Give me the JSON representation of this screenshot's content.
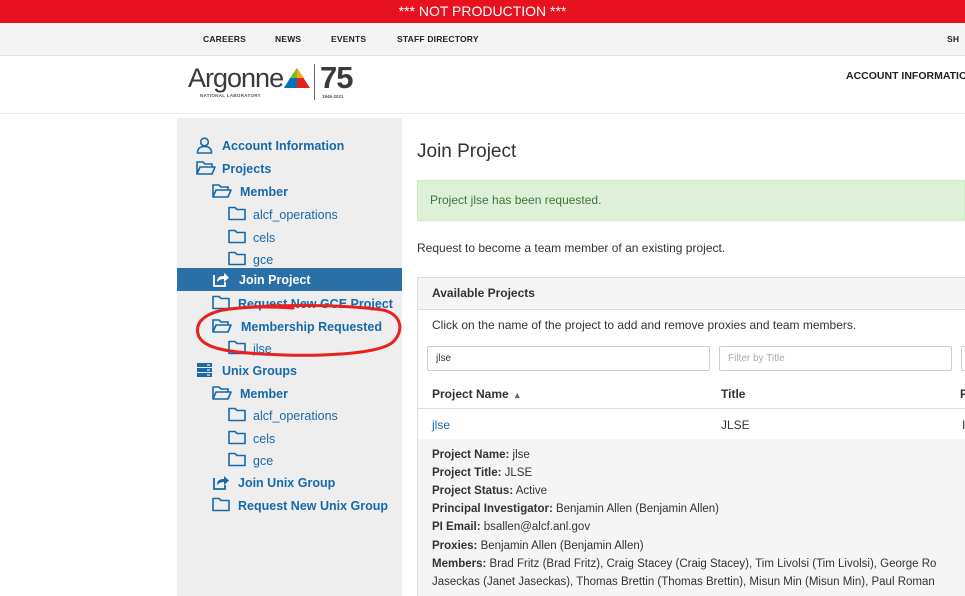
{
  "banner": {
    "text": "*** NOT PRODUCTION ***"
  },
  "topnav": {
    "careers": "CAREERS",
    "news": "NEWS",
    "events": "EVENTS",
    "staff_directory": "STAFF DIRECTORY",
    "right_partial": "SH"
  },
  "logo": {
    "name": "Argonne",
    "sub": "NATIONAL LABORATORY",
    "anniversary": "75",
    "years": "1946-2021"
  },
  "header": {
    "account_link": "ACCOUNT INFORMATIO"
  },
  "sidebar": {
    "account_information": "Account Information",
    "projects": "Projects",
    "member": "Member",
    "member_projects": [
      "alcf_operations",
      "cels",
      "gce"
    ],
    "join_project": "Join Project",
    "request_new_gce_project": "Request New GCE Project",
    "membership_requested": "Membership Requested",
    "requested_projects": [
      "jlse"
    ],
    "unix_groups": "Unix Groups",
    "unix_member": "Member",
    "unix_member_groups": [
      "alcf_operations",
      "cels",
      "gce"
    ],
    "join_unix_group": "Join Unix Group",
    "request_new_unix_group": "Request New Unix Group"
  },
  "main": {
    "title": "Join Project",
    "alert": "Project jlse has been requested.",
    "intro": "Request to become a team member of an existing project.",
    "panel_title": "Available Projects",
    "panel_desc": "Click on the name of the project to add and remove proxies and team members.",
    "filter_name_value": "jlse",
    "filter_title_placeholder": "Filter by Title",
    "columns": {
      "name": "Project Name",
      "sort_indicator": "▴",
      "title": "Title",
      "third_partial": "P"
    },
    "row": {
      "name": "jlse",
      "title": "JLSE",
      "third_partial": "I"
    },
    "details": {
      "project_name_label": "Project Name:",
      "project_name": "jlse",
      "project_title_label": "Project Title:",
      "project_title": "JLSE",
      "project_status_label": "Project Status:",
      "project_status": "Active",
      "pi_label": "Principal Investigator:",
      "pi": "Benjamin Allen (Benjamin Allen)",
      "pi_email_label": "PI Email:",
      "pi_email": "bsallen@alcf.anl.gov",
      "proxies_label": "Proxies:",
      "proxies": "Benjamin Allen (Benjamin Allen)",
      "members_label": "Members:",
      "members_line1": "Brad Fritz (Brad Fritz), Craig Stacey (Craig Stacey), Tim Livolsi (Tim Livolsi), George Ro",
      "members_line2": "Jaseckas (Janet Jaseckas), Thomas Brettin (Thomas Brettin), Misun Min (Misun Min), Paul Roman"
    }
  },
  "colors": {
    "banner": "#e8111f",
    "link": "#1769aa",
    "active": "#2a6fa8",
    "alert_bg": "#dff0d8",
    "annotation": "#e8211f"
  },
  "icons": {
    "account": "user-icon",
    "folder_open": "folder-open-icon",
    "folder": "folder-icon",
    "share": "share-icon",
    "server": "server-icon"
  }
}
